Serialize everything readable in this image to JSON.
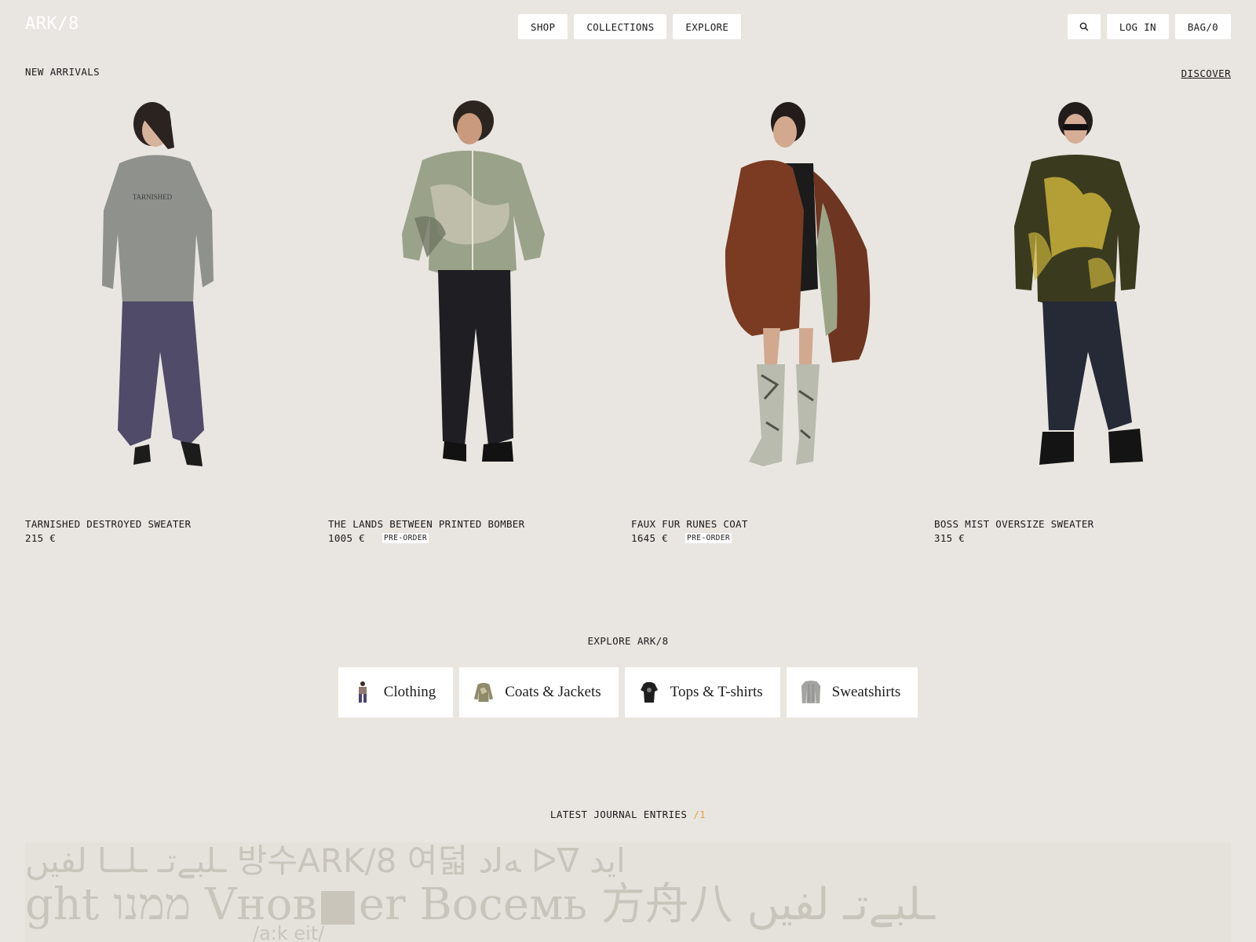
{
  "header": {
    "logo": "ARK/8",
    "nav": [
      {
        "label": "SHOP"
      },
      {
        "label": "COLLECTIONS"
      },
      {
        "label": "EXPLORE"
      }
    ],
    "login_label": "LOG IN",
    "bag_label": "BAG/0",
    "search_icon": "search-icon"
  },
  "new_arrivals": {
    "title": "NEW ARRIVALS",
    "discover_label": "DISCOVER",
    "products": [
      {
        "name": "TARNISHED DESTROYED SWEATER",
        "price": "215 €",
        "badge": "",
        "print": "TARNISHED"
      },
      {
        "name": "THE LANDS BETWEEN PRINTED BOMBER",
        "price": "1005 €",
        "badge": "PRE-ORDER"
      },
      {
        "name": "FAUX FUR RUNES COAT",
        "price": "1645 €",
        "badge": "PRE-ORDER"
      },
      {
        "name": "BOSS MIST OVERSIZE SWEATER",
        "price": "315 €",
        "badge": ""
      }
    ]
  },
  "explore": {
    "title": "EXPLORE ARK/8",
    "categories": [
      {
        "label": "Clothing"
      },
      {
        "label": "Coats & Jackets"
      },
      {
        "label": "Tops & T-shirts"
      },
      {
        "label": "Sweatshirts"
      }
    ]
  },
  "journal": {
    "title": "LATEST JOURNAL ENTRIES",
    "count": "/1",
    "banner_text": {
      "line1": "ـلبےتـ ـلــا لفيں 방수ARK/8 여덟 ﻪﻟﺩ ᐅᐁ ﺍﻳﺪ",
      "line2": "ght ממנו Vнов■er Восемь 方舟八 ـلبےتـ لفيں",
      "line3": "/a:k eit/"
    }
  },
  "colors": {
    "background": "#e9e6e1",
    "accent": "#e6a23c",
    "pill": "#ffffff",
    "banner_glyph": "#c9c5bb"
  }
}
